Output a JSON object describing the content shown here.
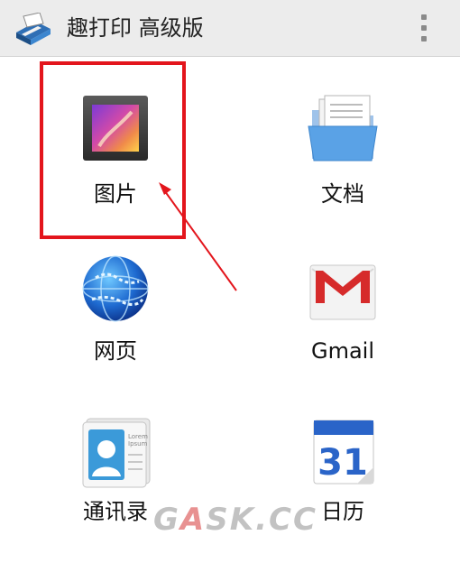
{
  "app": {
    "title": "趣打印 高级版"
  },
  "tiles": [
    {
      "label": "图片",
      "icon": "photo-gallery-icon"
    },
    {
      "label": "文档",
      "icon": "folder-document-icon"
    },
    {
      "label": "网页",
      "icon": "globe-icon"
    },
    {
      "label": "Gmail",
      "icon": "gmail-icon"
    },
    {
      "label": "通讯录",
      "icon": "contacts-icon"
    },
    {
      "label": "日历",
      "icon": "calendar-icon"
    }
  ],
  "calendar_icon_day": "31",
  "contacts_icon_text": [
    "Lorem",
    "Ipsum"
  ],
  "annotation": {
    "highlight_color": "#e3151c"
  },
  "watermark": {
    "part1": "G",
    "accent": "A",
    "part2": "SK.CC"
  }
}
